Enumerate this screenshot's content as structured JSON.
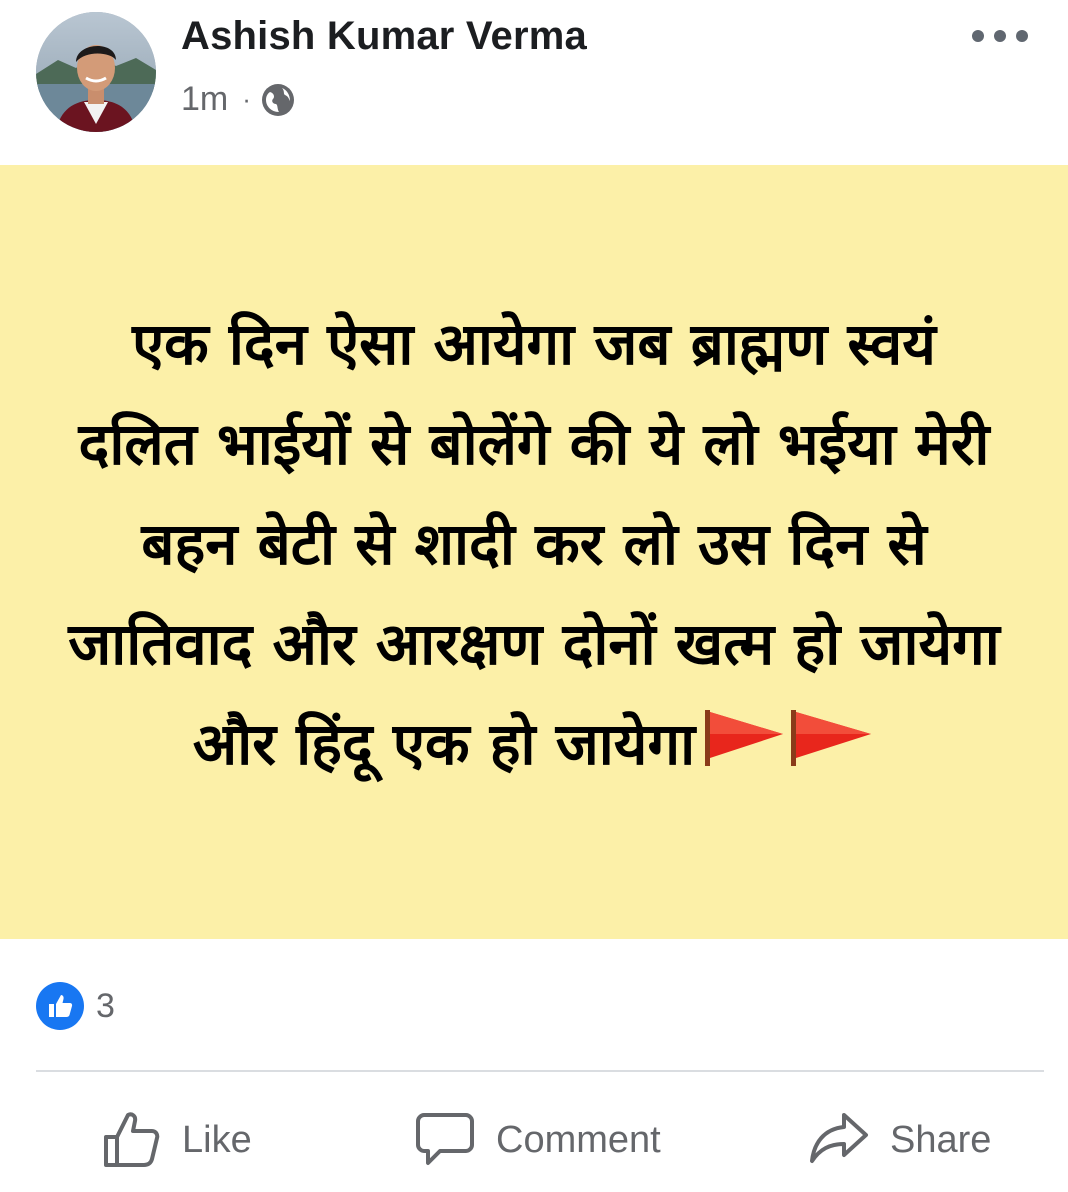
{
  "author": {
    "name": "Ashish Kumar Verma",
    "time": "1m",
    "separator": "·",
    "privacy_icon": "globe-icon"
  },
  "menu_icon": "more-horizontal-icon",
  "post": {
    "background": "#fcf0a8",
    "text": "एक दिन ऐसा आयेगा जब ब्राह्मण स्वयं दलित भाईयों से बोलेंगे की ये लो भईया मेरी बहन बेटी से शादी कर लो उस दिन से जातिवाद और आरक्षण दोनों खत्म हो जायेगा और हिंदू एक हो जायेगा",
    "emoji": "triangular-flag-icon"
  },
  "reactions": {
    "icon": "like-reaction-icon",
    "count": "3"
  },
  "actions": {
    "like_label": "Like",
    "comment_label": "Comment",
    "share_label": "Share"
  },
  "colors": {
    "accent": "#1877f2",
    "secondary_text": "#65676b",
    "flag": "#e8261c"
  }
}
